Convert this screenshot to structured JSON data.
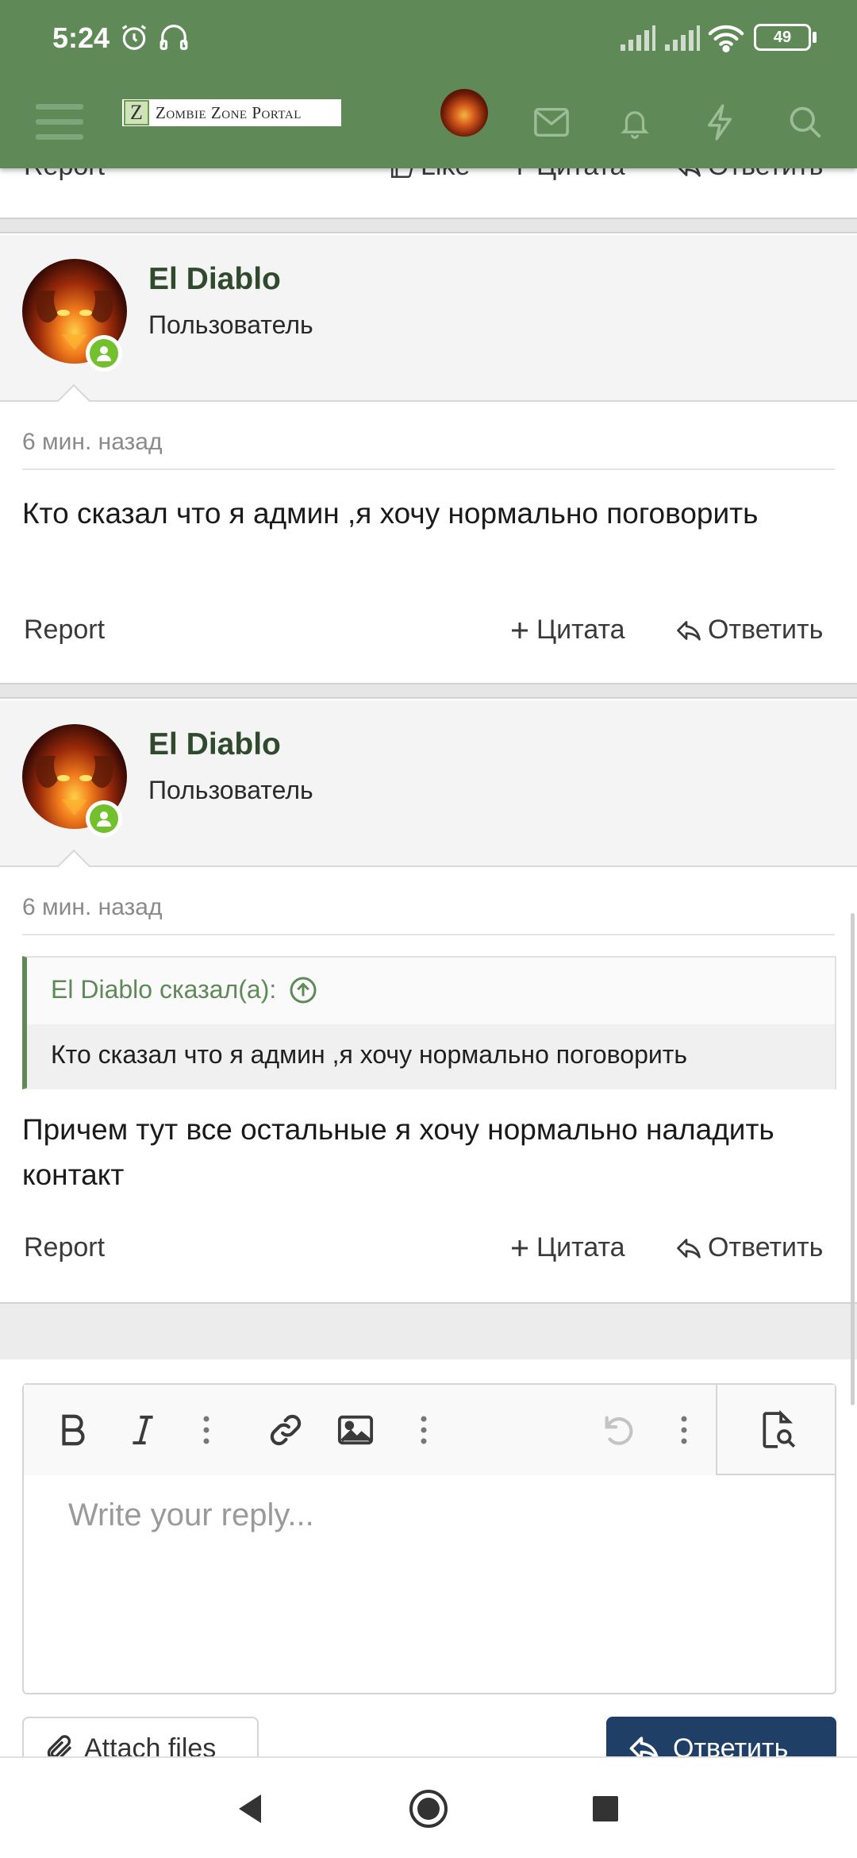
{
  "status_bar": {
    "time": "5:24",
    "battery": "49"
  },
  "nav": {
    "logo_letter": "Z",
    "logo_text": "Zombie Zone Portal"
  },
  "cut_post": {
    "report": "Report",
    "like": "Like",
    "quote": "Цитата",
    "reply": "Ответить"
  },
  "posts": [
    {
      "username": "El Diablo",
      "user_title": "Пользователь",
      "time": "6 мин. назад",
      "text": "Кто сказал что я админ ,я хочу нормально поговорить",
      "report": "Report",
      "quote": "Цитата",
      "reply": "Ответить"
    },
    {
      "username": "El Diablo",
      "user_title": "Пользователь",
      "time": "6 мин. назад",
      "quote_header": "El Diablo сказал(а):",
      "quote_text": "Кто сказал что я админ ,я хочу нормально поговорить",
      "text": "Причем тут все остальные я хочу нормально наладить контакт",
      "report": "Report",
      "quote": "Цитата",
      "reply": "Ответить"
    }
  ],
  "editor": {
    "placeholder": "Write your reply...",
    "attach_label": "Attach files",
    "reply_label": "Ответить"
  },
  "colors": {
    "header": "#5f8a58",
    "username": "#2f4a2c",
    "online": "#72c02c",
    "reply_button": "#1f3f66"
  },
  "icons": [
    "menu-icon",
    "avatar",
    "mail-icon",
    "bell-icon",
    "bolt-icon",
    "search-icon",
    "bold-icon",
    "italic-icon",
    "more-icon",
    "link-icon",
    "image-icon",
    "undo-icon",
    "preview-icon",
    "paperclip-icon",
    "reply-arrow-icon",
    "plus-icon"
  ]
}
